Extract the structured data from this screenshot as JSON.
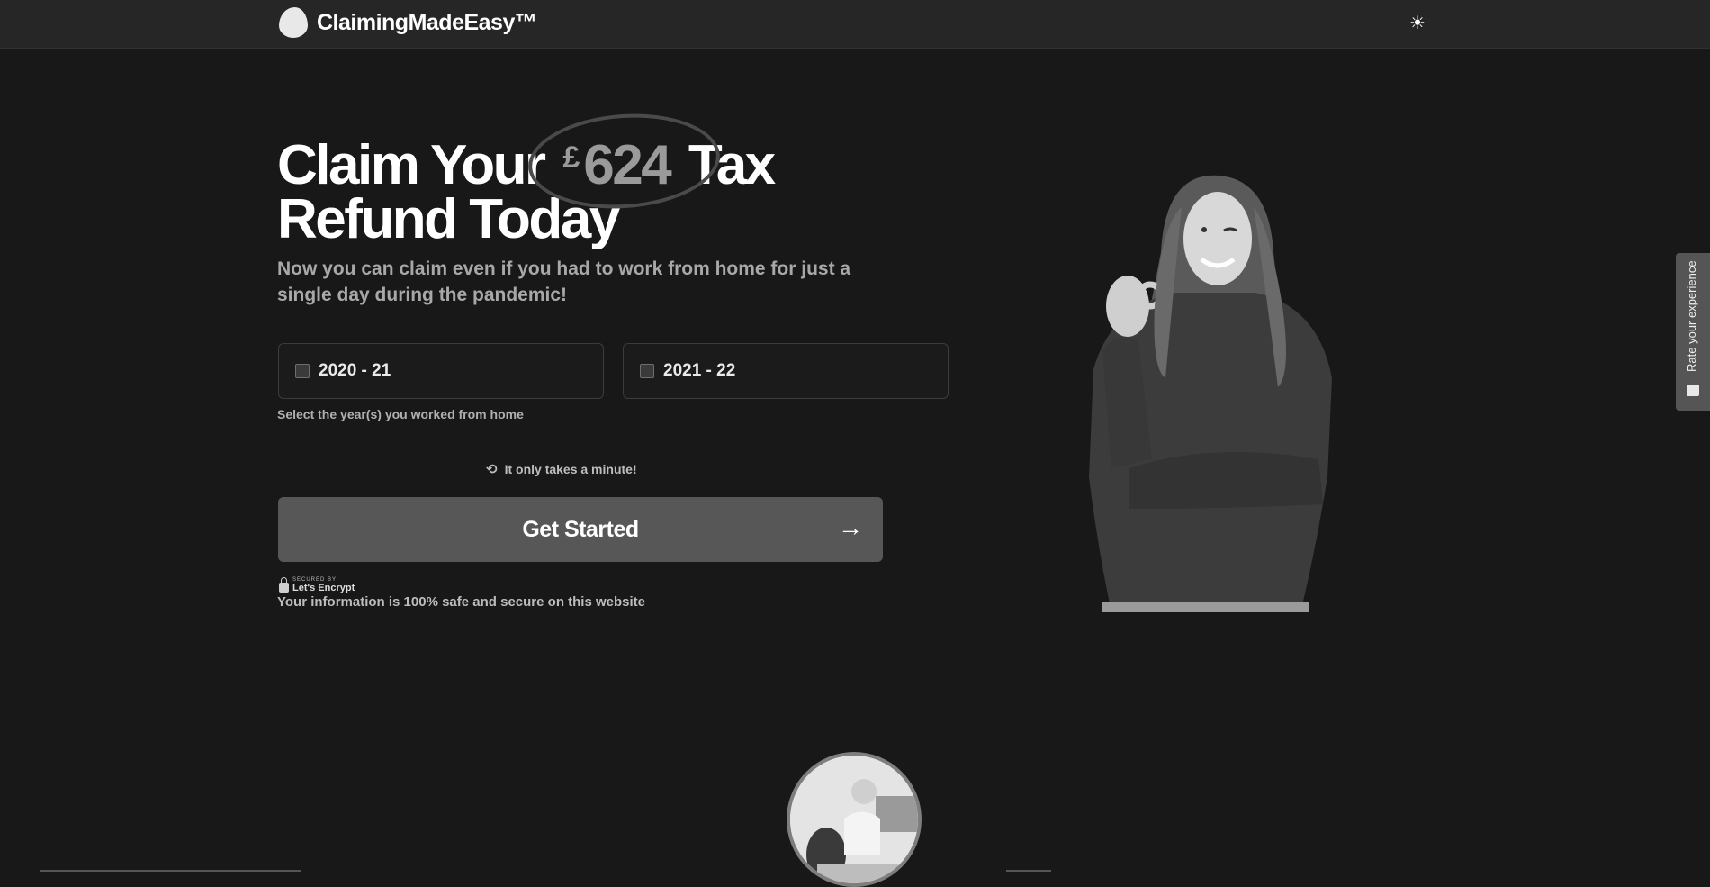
{
  "header": {
    "brand": "ClaimingMadeEasy™",
    "logo_icon": "droplet-logo-icon",
    "theme_toggle_icon": "sun-icon"
  },
  "hero": {
    "title_part1": "Claim Your",
    "currency_symbol": "£",
    "amount": "624",
    "title_part2": "Tax",
    "title_line2": "Refund Today",
    "subtitle": "Now you can claim even if you had to work from home for just a single day during the pandemic!"
  },
  "form": {
    "years": [
      {
        "label": "2020 - 21",
        "checked": false
      },
      {
        "label": "2021 - 22",
        "checked": false
      }
    ],
    "help_text": "Select the year(s) you worked from home",
    "time_note": "It only takes a minute!",
    "time_icon": "history-clock-icon",
    "cta_label": "Get Started",
    "cta_icon": "arrow-right-icon"
  },
  "security": {
    "badge_small": "SECURED BY",
    "badge_name": "Let's Encrypt",
    "text": "Your information is 100% safe and secure on this website"
  },
  "feedback": {
    "label": "Rate your experience",
    "icon": "feedback-icon"
  },
  "colors": {
    "background": "#181818",
    "topbar": "#262626",
    "button": "#575757",
    "muted_text": "#a8a8a8"
  }
}
